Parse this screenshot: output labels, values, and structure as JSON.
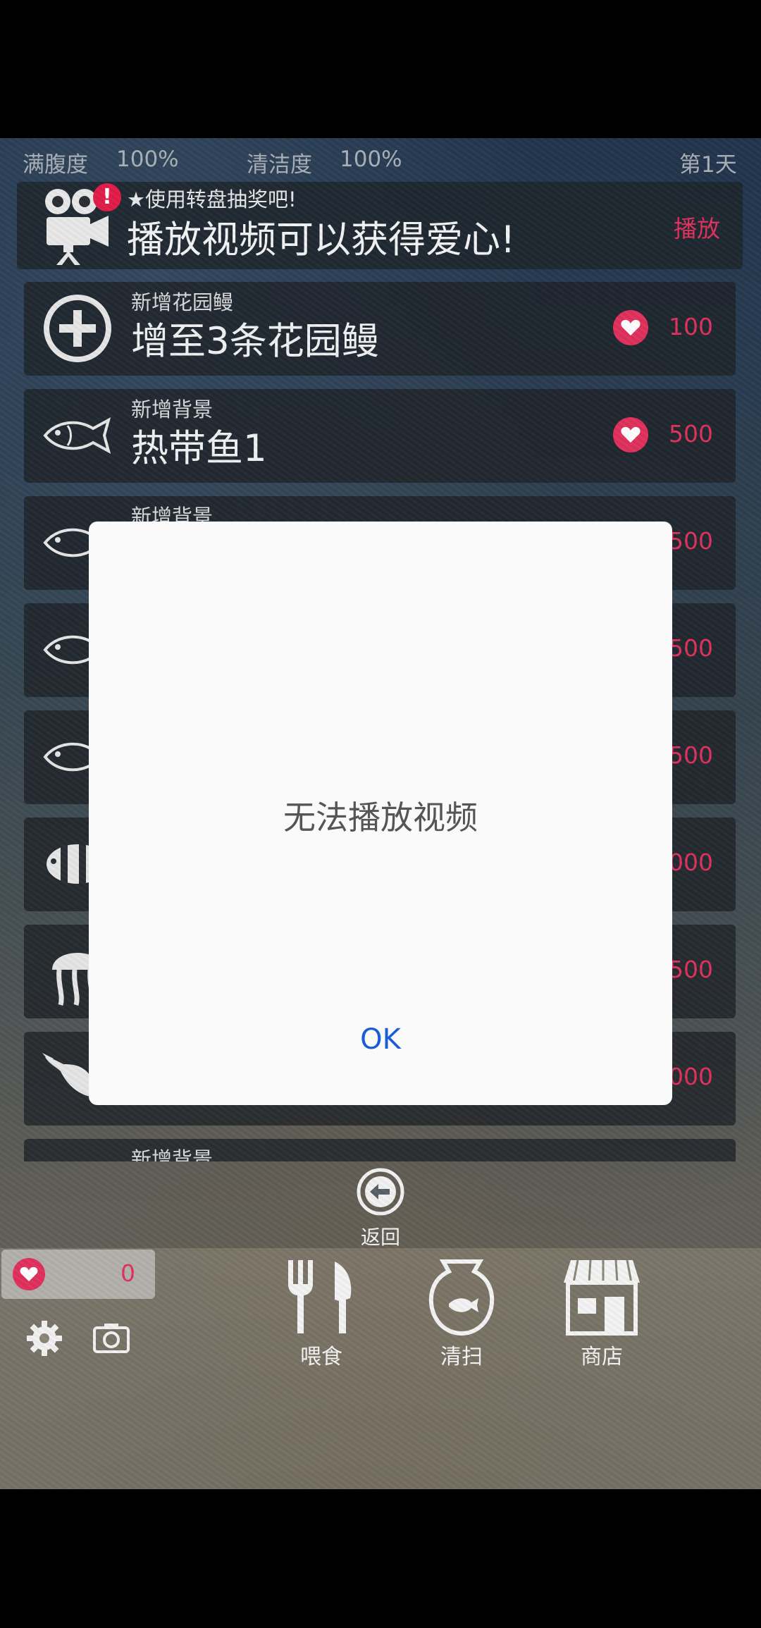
{
  "status": {
    "satiety_label": "满腹度",
    "satiety_value": "100%",
    "clean_label": "清洁度",
    "clean_value": "100%",
    "day": "第1天"
  },
  "promo": {
    "subtitle": "★使用转盘抽奖吧!",
    "title": "播放视频可以获得爱心!",
    "action": "播放",
    "badge": "!"
  },
  "shop_items": [
    {
      "subtitle": "新增花园鳗",
      "title": "增至3条花园鳗",
      "price": "100",
      "icon": "plus-circle-icon"
    },
    {
      "subtitle": "新增背景",
      "title": "热带鱼1",
      "price": "500",
      "icon": "fish-icon"
    },
    {
      "subtitle": "新增背景",
      "title": "",
      "price": "500",
      "icon": "fish-icon"
    },
    {
      "subtitle": "",
      "title": "",
      "price": "500",
      "icon": "fish-icon"
    },
    {
      "subtitle": "",
      "title": "",
      "price": "500",
      "icon": "fish-icon"
    },
    {
      "subtitle": "",
      "title": "",
      "price": "000",
      "icon": "clownfish-icon"
    },
    {
      "subtitle": "",
      "title": "",
      "price": "500",
      "icon": "jellyfish-icon"
    },
    {
      "subtitle": "",
      "title": "",
      "price": "000",
      "icon": "dolphin-icon"
    },
    {
      "subtitle": "新增背景",
      "title": "",
      "price": "",
      "icon": "fish-icon"
    }
  ],
  "back_label": "返回",
  "hearts": "0",
  "tools": {
    "feed": "喂食",
    "clean": "清扫",
    "shop": "商店"
  },
  "dialog": {
    "message": "无法播放视频",
    "ok": "OK"
  },
  "colors": {
    "accent": "#e0315d",
    "dialog_button": "#1a5bd6"
  }
}
